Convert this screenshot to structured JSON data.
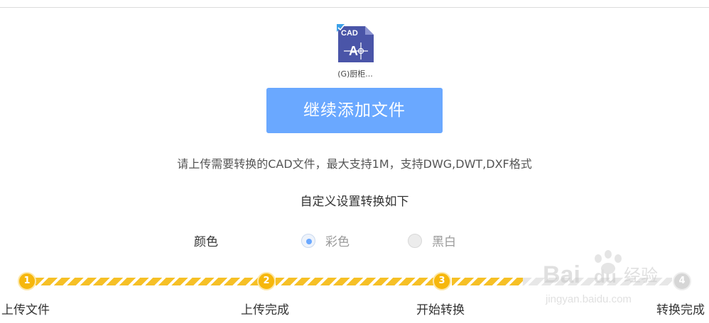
{
  "file": {
    "icon_text": "CAD",
    "icon_glyph": "A",
    "caption": "(G)厨柜..."
  },
  "buttons": {
    "continue_label": "继续添加文件"
  },
  "hint": "请上传需要转换的CAD文件，最大支持1M，支持DWG,DWT,DXF格式",
  "settings": {
    "title": "自定义设置转换如下",
    "color_label": "颜色",
    "options": [
      {
        "label": "彩色",
        "selected": true
      },
      {
        "label": "黑白",
        "selected": false
      }
    ]
  },
  "steps": [
    {
      "number": "1",
      "label": "上传文件",
      "active": true
    },
    {
      "number": "2",
      "label": "上传完成",
      "active": true
    },
    {
      "number": "3",
      "label": "开始转换",
      "active": true
    },
    {
      "number": "4",
      "label": "转换完成",
      "active": false
    }
  ],
  "watermark": {
    "brand_left": "Bai",
    "brand_right": "du",
    "suffix": "经验",
    "url": "jingyan.baidu.com"
  },
  "colors": {
    "accent_blue": "#6aa8ff",
    "progress_yellow": "#f6b70c",
    "file_icon": "#4a55a8"
  }
}
